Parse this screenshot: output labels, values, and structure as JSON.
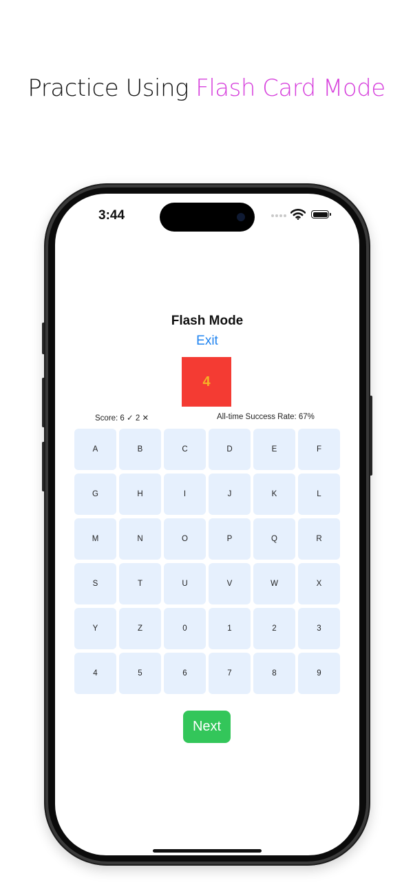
{
  "promo": {
    "headline_prefix": "Practice Using ",
    "headline_accent": "Flash Card Mode",
    "accent_color": "#d63fdc"
  },
  "status_bar": {
    "time": "3:44",
    "icons": [
      "cellular-dots-icon",
      "wifi-icon",
      "battery-icon"
    ]
  },
  "screen": {
    "title": "Flash Mode",
    "exit_label": "Exit",
    "card_value": "4",
    "card_bg_color": "#f43b33",
    "card_text_color": "#f5b326",
    "score_label": "Score: 6 ✓   2 ✕",
    "success_rate_label": "All-time Success Rate: 67%",
    "keys": [
      "A",
      "B",
      "C",
      "D",
      "E",
      "F",
      "G",
      "H",
      "I",
      "J",
      "K",
      "L",
      "M",
      "N",
      "O",
      "P",
      "Q",
      "R",
      "S",
      "T",
      "U",
      "V",
      "W",
      "X",
      "Y",
      "Z",
      "0",
      "1",
      "2",
      "3",
      "4",
      "5",
      "6",
      "7",
      "8",
      "9"
    ],
    "next_label": "Next",
    "next_color": "#33c65a"
  }
}
